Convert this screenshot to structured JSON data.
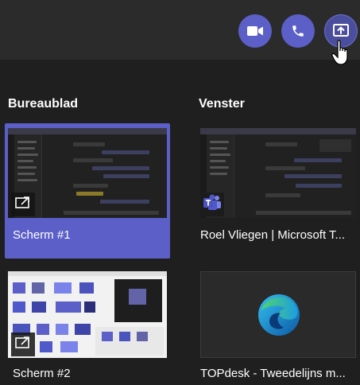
{
  "topbar": {
    "buttons": [
      {
        "name": "video-camera-icon",
        "label": "Video"
      },
      {
        "name": "phone-icon",
        "label": "Audio call"
      },
      {
        "name": "share-screen-icon",
        "label": "Share content"
      }
    ]
  },
  "sections": {
    "desktop_title": "Bureaublad",
    "window_title": "Venster"
  },
  "tiles": [
    {
      "label": "Scherm #1",
      "kind": "screen",
      "selected": true
    },
    {
      "label": "Roel Vliegen | Microsoft T...",
      "kind": "window",
      "app": "teams-icon"
    },
    {
      "label": "Scherm #2",
      "kind": "screen"
    },
    {
      "label": "TOPdesk - Tweedelijns m...",
      "kind": "window",
      "app": "edge-icon"
    }
  ],
  "colors": {
    "accent": "#5b5fc7",
    "background": "#1f1f1f",
    "topbar": "#2b2b2b"
  }
}
